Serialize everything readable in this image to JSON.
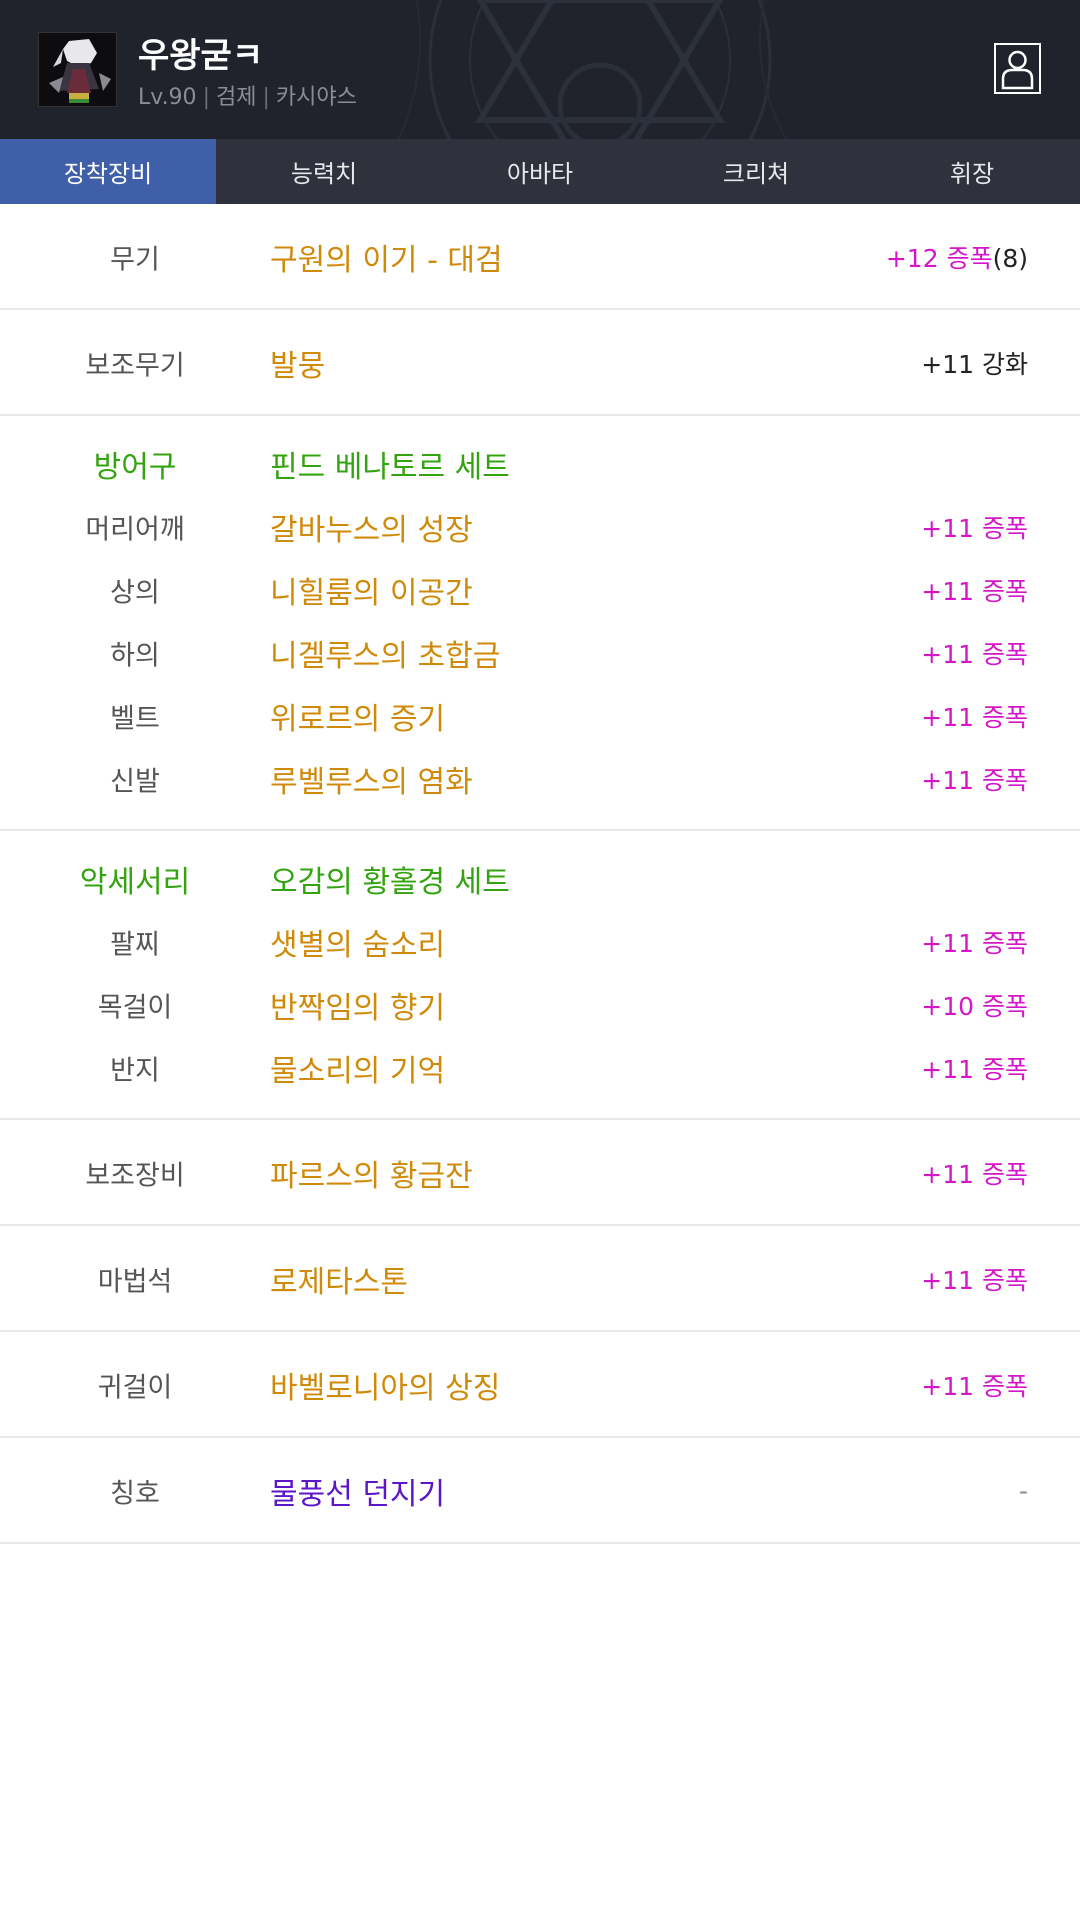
{
  "character": {
    "name": "우왕굳ㅋ",
    "level": "Lv.90",
    "job": "검제",
    "server": "카시야스"
  },
  "tabs": [
    {
      "label": "장착장비",
      "active": true
    },
    {
      "label": "능력치",
      "active": false
    },
    {
      "label": "아바타",
      "active": false
    },
    {
      "label": "크리쳐",
      "active": false
    },
    {
      "label": "휘장",
      "active": false
    }
  ],
  "weapon": {
    "slot": "무기",
    "item": "구원의 이기 - 대검",
    "upgrade": "+12 증폭",
    "upgrade_extra": "(8)"
  },
  "subweapon": {
    "slot": "보조무기",
    "item": "발뭉",
    "upgrade": "+11 강화"
  },
  "armor": {
    "group": "방어구",
    "set": "핀드 베나토르 세트",
    "items": [
      {
        "slot": "머리어깨",
        "item": "갈바누스의 성장",
        "upgrade": "+11 증폭"
      },
      {
        "slot": "상의",
        "item": "니힐룸의 이공간",
        "upgrade": "+11 증폭"
      },
      {
        "slot": "하의",
        "item": "니겔루스의 초합금",
        "upgrade": "+11 증폭"
      },
      {
        "slot": "벨트",
        "item": "위로르의 증기",
        "upgrade": "+11 증폭"
      },
      {
        "slot": "신발",
        "item": "루벨루스의 염화",
        "upgrade": "+11 증폭"
      }
    ]
  },
  "accessory": {
    "group": "악세서리",
    "set": "오감의 황홀경 세트",
    "items": [
      {
        "slot": "팔찌",
        "item": "샛별의 숨소리",
        "upgrade": "+11 증폭"
      },
      {
        "slot": "목걸이",
        "item": "반짝임의 향기",
        "upgrade": "+10 증폭"
      },
      {
        "slot": "반지",
        "item": "물소리의 기억",
        "upgrade": "+11 증폭"
      }
    ]
  },
  "support": {
    "slot": "보조장비",
    "item": "파르스의 황금잔",
    "upgrade": "+11 증폭"
  },
  "magicstone": {
    "slot": "마법석",
    "item": "로제타스톤",
    "upgrade": "+11 증폭"
  },
  "earring": {
    "slot": "귀걸이",
    "item": "바벨로니아의 상징",
    "upgrade": "+11 증폭"
  },
  "title": {
    "slot": "칭호",
    "item": "물풍선 던지기",
    "upgrade": "-"
  },
  "colors": {
    "header_bg": "#20232c",
    "tab_active": "#3f5fa8",
    "item_gold": "#d08a0a",
    "set_green": "#33a30f",
    "upgrade_magenta": "#d516c8",
    "title_purple": "#5a16c8"
  }
}
